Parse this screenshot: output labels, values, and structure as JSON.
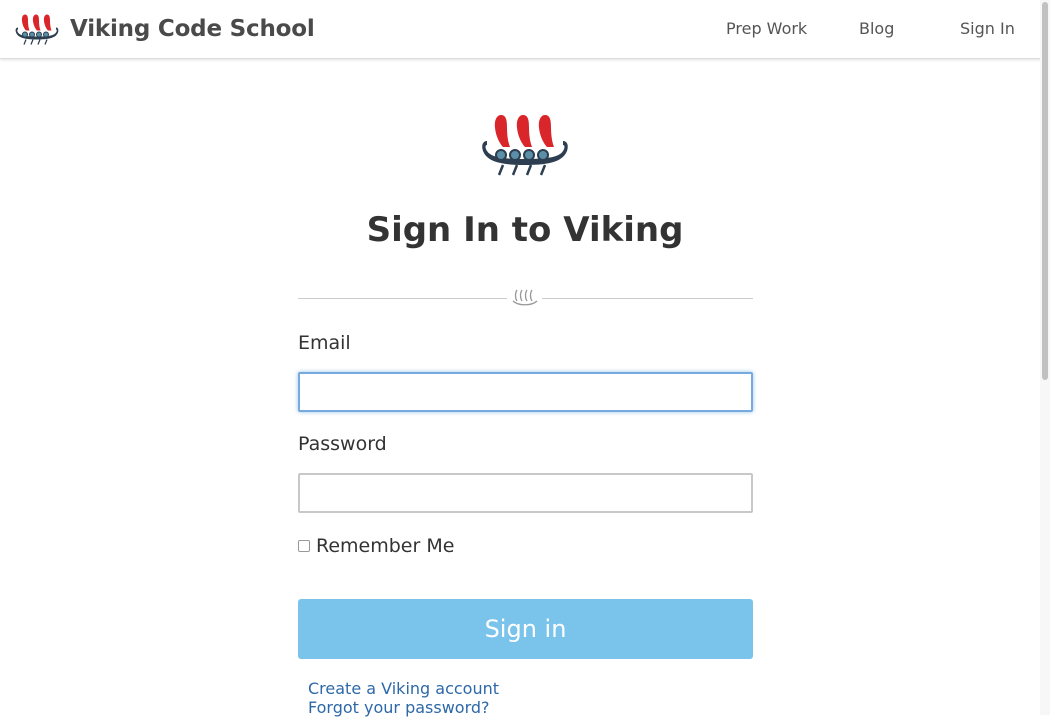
{
  "navbar": {
    "brand_name": "Viking Code School",
    "links": [
      {
        "label": "Prep Work"
      },
      {
        "label": "Blog"
      },
      {
        "label": "Sign In"
      }
    ]
  },
  "icons": {
    "brand_logo": "viking-ship-icon",
    "main_logo": "viking-ship-icon",
    "divider": "sails-divider-icon"
  },
  "colors": {
    "sail_red": "#d9262b",
    "hull_dark": "#2c3e50",
    "shield_blue": "#5b8fa8",
    "button_bg": "#7ac4ec",
    "link": "#2d68a8"
  },
  "page": {
    "title": "Sign In to Viking"
  },
  "form": {
    "email_label": "Email",
    "email_value": "",
    "password_label": "Password",
    "password_value": "",
    "remember_label": "Remember Me",
    "submit_label": "Sign in"
  },
  "links": {
    "create_account": "Create a Viking account",
    "forgot_password": "Forgot your password?"
  }
}
